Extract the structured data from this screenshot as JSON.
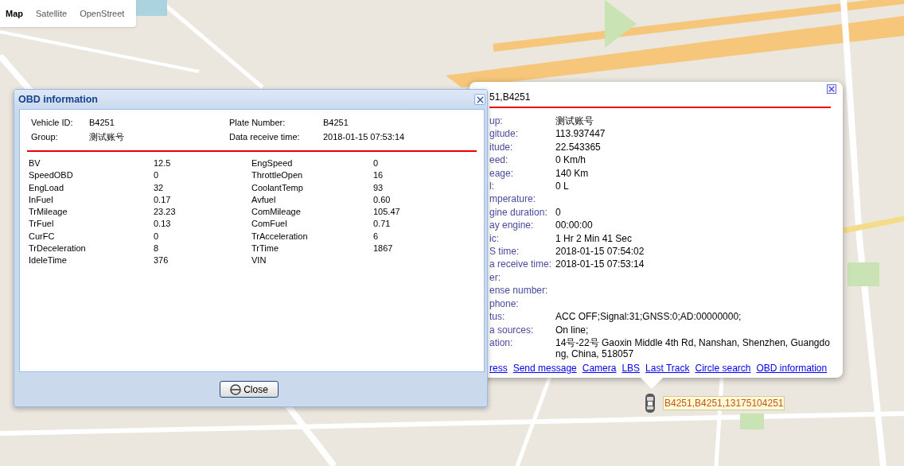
{
  "map_type_control": {
    "options": [
      {
        "label": "Map",
        "selected": true
      },
      {
        "label": "Satellite",
        "selected": false
      },
      {
        "label": "OpenStreet",
        "selected": false
      }
    ]
  },
  "obd_dialog": {
    "title": "OBD information",
    "header": [
      {
        "label": "Vehicle ID:",
        "value": "B4251"
      },
      {
        "label": "Plate Number:",
        "value": "B4251"
      },
      {
        "label": "Group:",
        "value": "测试账号"
      },
      {
        "label": "Data receive time:",
        "value": "2018-01-15 07:53:14"
      }
    ],
    "rows": [
      {
        "label": "BV",
        "value": "12.5"
      },
      {
        "label": "EngSpeed",
        "value": "0"
      },
      {
        "label": "SpeedOBD",
        "value": "0"
      },
      {
        "label": "ThrottleOpen",
        "value": "16"
      },
      {
        "label": "EngLoad",
        "value": "32"
      },
      {
        "label": "CoolantTemp",
        "value": "93"
      },
      {
        "label": "InFuel",
        "value": "0.17"
      },
      {
        "label": "Avfuel",
        "value": "0.60"
      },
      {
        "label": "TrMileage",
        "value": "23.23"
      },
      {
        "label": "ComMileage",
        "value": "105.47"
      },
      {
        "label": "TrFuel",
        "value": "0.13"
      },
      {
        "label": "ComFuel",
        "value": "0.71"
      },
      {
        "label": "CurFC",
        "value": "0"
      },
      {
        "label": "TrAcceleration",
        "value": "6"
      },
      {
        "label": "TrDeceleration",
        "value": "8"
      },
      {
        "label": "TrTime",
        "value": "1867"
      },
      {
        "label": "IdeleTime",
        "value": "376"
      },
      {
        "label": "VIN"
      }
    ],
    "close_button": "Close"
  },
  "info_popup": {
    "title": "51,B4251",
    "fields": [
      {
        "label": "up:",
        "value": "测试账号"
      },
      {
        "label": "gitude:",
        "value": "113.937447"
      },
      {
        "label": "itude:",
        "value": "22.543365"
      },
      {
        "label": "eed:",
        "value": "0 Km/h"
      },
      {
        "label": "eage:",
        "value": "140 Km"
      },
      {
        "label": "l:",
        "value": "0 L"
      },
      {
        "label": "mperature:"
      },
      {
        "label": "gine duration:",
        "value": "0"
      },
      {
        "label": "ay engine:",
        "value": "00:00:00"
      },
      {
        "label": "ic:",
        "value": "1 Hr 2 Min 41 Sec"
      },
      {
        "label": "S time:",
        "value": "2018-01-15 07:54:02"
      },
      {
        "label": "a receive time:",
        "value": "2018-01-15 07:53:14"
      },
      {
        "label": "er:"
      },
      {
        "label": "ense number:"
      },
      {
        "label": "phone:"
      },
      {
        "label": "tus:",
        "value": "ACC OFF;Signal:31;GNSS:0;AD:00000000;"
      },
      {
        "label": "a sources:",
        "value": "On line;"
      },
      {
        "label": "ation:",
        "value": "14号-22号 Gaoxin Middle 4th Rd, Nanshan, Shenzhen, Guangdong, China, 518057"
      }
    ],
    "links": [
      "ress",
      "Send message",
      "Camera",
      "LBS",
      "Last Track",
      "Circle search",
      "OBD information"
    ]
  },
  "vehicle_marker": {
    "label": "B4251,B4251,13175104251"
  }
}
